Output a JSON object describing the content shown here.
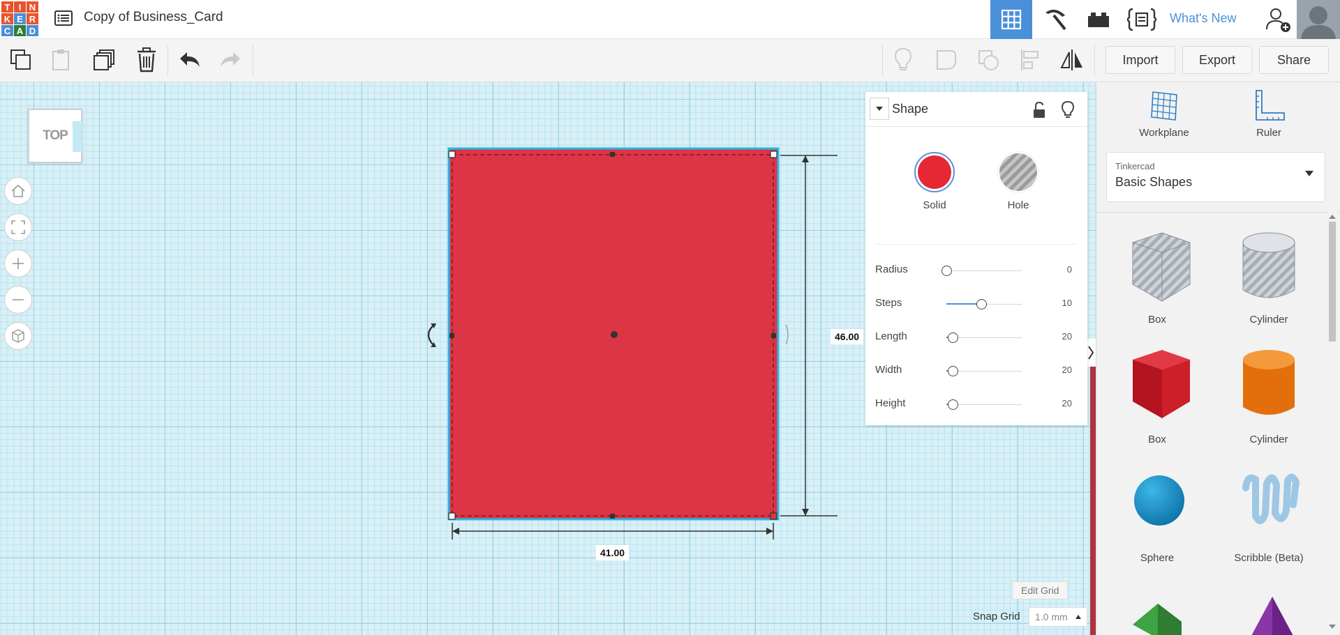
{
  "app": {
    "logo_letters": [
      "T",
      "I",
      "N",
      "K",
      "E",
      "R",
      "C",
      "A",
      "D"
    ],
    "logo_colors": [
      "#e7542b",
      "#e7542b",
      "#e7542b",
      "#e7542b",
      "#4a90d9",
      "#e7542b",
      "#4a90d9",
      "#2e7d32",
      "#4a90d9"
    ],
    "document_title": "Copy of Business_Card",
    "whats_new": "What's New"
  },
  "header_icons": [
    "grid-view-icon",
    "pickaxe-icon",
    "bricks-icon",
    "code-blocks-icon",
    "add-user-icon"
  ],
  "toolbar": {
    "import_label": "Import",
    "export_label": "Export",
    "share_label": "Share"
  },
  "viewcube": {
    "label": "TOP"
  },
  "shape": {
    "color": "#dc3545",
    "width_label": "41.00",
    "length_label": "46.00"
  },
  "inspector": {
    "title": "Shape",
    "solid_label": "Solid",
    "hole_label": "Hole",
    "solid_color": "#e52833",
    "properties": [
      {
        "name": "Radius",
        "value": "0",
        "fraction": 0.0
      },
      {
        "name": "Steps",
        "value": "10",
        "fraction": 0.46
      },
      {
        "name": "Length",
        "value": "20",
        "fraction": 0.08
      },
      {
        "name": "Width",
        "value": "20",
        "fraction": 0.08
      },
      {
        "name": "Height",
        "value": "20",
        "fraction": 0.08
      }
    ]
  },
  "library": {
    "workplane_label": "Workplane",
    "ruler_label": "Ruler",
    "source_label": "Tinkercad",
    "category_label": "Basic Shapes",
    "shapes": [
      {
        "name": "Box",
        "style": "hole-box"
      },
      {
        "name": "Cylinder",
        "style": "hole-cylinder"
      },
      {
        "name": "Box",
        "style": "red-box"
      },
      {
        "name": "Cylinder",
        "style": "orange-cylinder"
      },
      {
        "name": "Sphere",
        "style": "blue-sphere"
      },
      {
        "name": "Scribble (Beta)",
        "style": "scribble"
      }
    ]
  },
  "grid": {
    "edit_grid_label": "Edit Grid",
    "snap_grid_label": "Snap Grid",
    "snap_value": "1.0 mm"
  }
}
